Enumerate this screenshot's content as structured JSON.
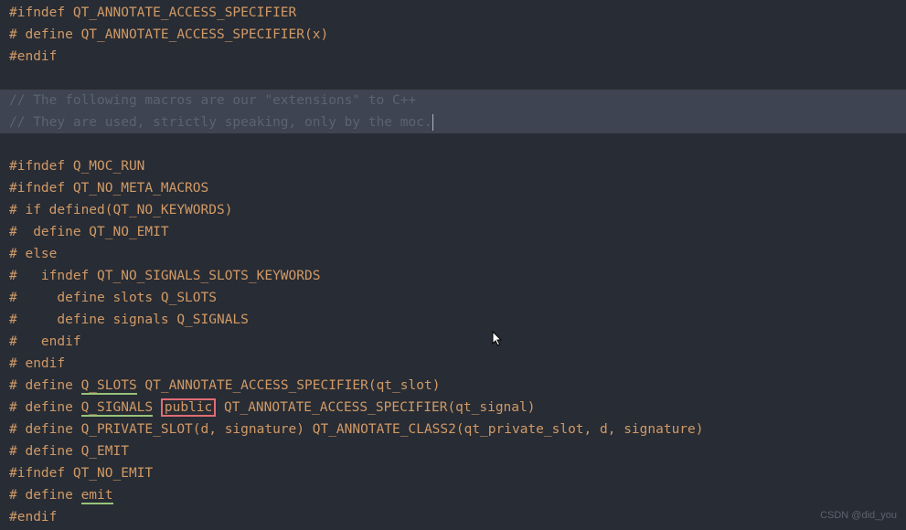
{
  "lines": {
    "l1": "#ifndef QT_ANNOTATE_ACCESS_SPECIFIER",
    "l2": "# define QT_ANNOTATE_ACCESS_SPECIFIER(x)",
    "l3": "#endif",
    "l4": "",
    "l5": "// The following macros are our \"extensions\" to C++",
    "l6": "// They are used, strictly speaking, only by the moc.",
    "l7": "",
    "l8": "#ifndef Q_MOC_RUN",
    "l9": "#ifndef QT_NO_META_MACROS",
    "l10": "# if defined(QT_NO_KEYWORDS)",
    "l11": "#  define QT_NO_EMIT",
    "l12": "# else",
    "l13": "#   ifndef QT_NO_SIGNALS_SLOTS_KEYWORDS",
    "l14": "#     define slots Q_SLOTS",
    "l15": "#     define signals Q_SIGNALS",
    "l16": "#   endif",
    "l17": "# endif",
    "l18_a": "# define ",
    "l18_b": "Q_SLOTS",
    "l18_c": " QT_ANNOTATE_ACCESS_SPECIFIER(qt_slot)",
    "l19_a": "# define ",
    "l19_b": "Q_SIGNALS",
    "l19_c": " ",
    "l19_d": "public",
    "l19_e": " QT_ANNOTATE_ACCESS_SPECIFIER(qt_signal)",
    "l20": "# define Q_PRIVATE_SLOT(d, signature) QT_ANNOTATE_CLASS2(qt_private_slot, d, signature)",
    "l21": "# define Q_EMIT",
    "l22": "#ifndef QT_NO_EMIT",
    "l23_a": "# define ",
    "l23_b": "emit",
    "l24": "#endif"
  },
  "watermark": "CSDN @did_you"
}
